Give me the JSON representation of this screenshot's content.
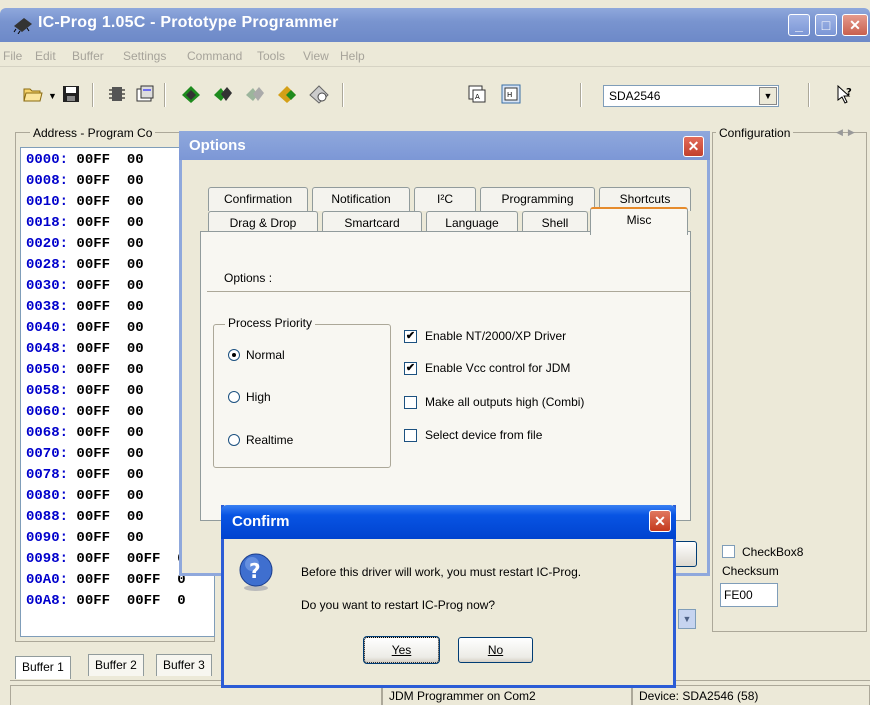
{
  "window": {
    "title": "IC-Prog 1.05C - Prototype Programmer",
    "min": "_",
    "max": "□",
    "close": "✕"
  },
  "menu": [
    "File",
    "Edit",
    "Buffer",
    "Settings",
    "Command",
    "Tools",
    "View",
    "Help"
  ],
  "toolbar": {
    "device": "SDA2546"
  },
  "address_panel": {
    "caption": "Address - Program Co",
    "rows": [
      {
        "addr": "0000:",
        "data": "00FF  00"
      },
      {
        "addr": "0008:",
        "data": "00FF  00"
      },
      {
        "addr": "0010:",
        "data": "00FF  00"
      },
      {
        "addr": "0018:",
        "data": "00FF  00"
      },
      {
        "addr": "0020:",
        "data": "00FF  00"
      },
      {
        "addr": "0028:",
        "data": "00FF  00"
      },
      {
        "addr": "0030:",
        "data": "00FF  00"
      },
      {
        "addr": "0038:",
        "data": "00FF  00"
      },
      {
        "addr": "0040:",
        "data": "00FF  00"
      },
      {
        "addr": "0048:",
        "data": "00FF  00"
      },
      {
        "addr": "0050:",
        "data": "00FF  00"
      },
      {
        "addr": "0058:",
        "data": "00FF  00"
      },
      {
        "addr": "0060:",
        "data": "00FF  00"
      },
      {
        "addr": "0068:",
        "data": "00FF  00"
      },
      {
        "addr": "0070:",
        "data": "00FF  00"
      },
      {
        "addr": "0078:",
        "data": "00FF  00"
      },
      {
        "addr": "0080:",
        "data": "00FF  00"
      },
      {
        "addr": "0088:",
        "data": "00FF  00"
      },
      {
        "addr": "0090:",
        "data": "00FF  00"
      },
      {
        "addr": "0098:",
        "data": "00FF  00FF  0"
      },
      {
        "addr": "00A0:",
        "data": "00FF  00FF  0"
      },
      {
        "addr": "00A8:",
        "data": "00FF  00FF  0"
      }
    ]
  },
  "config_panel": {
    "caption": "Configuration",
    "checkbox8": "CheckBox8",
    "checksum_label": "Checksum",
    "checksum_value": "FE00"
  },
  "buffer_tabs": [
    "Buffer 1",
    "Buffer 2",
    "Buffer 3"
  ],
  "status": {
    "programmer": "JDM Programmer on Com2",
    "device": "Device: SDA2546  (58)"
  },
  "options_dialog": {
    "title": "Options",
    "tabs_row1": [
      "Confirmation",
      "Notification",
      "I²C",
      "Programming",
      "Shortcuts"
    ],
    "tabs_row2": [
      "Drag & Drop",
      "Smartcard",
      "Language",
      "Shell",
      "Misc"
    ],
    "active_tab": "Misc",
    "panel_label": "Options :",
    "priority_caption": "Process Priority",
    "priorities": [
      {
        "label": "Normal",
        "selected": true
      },
      {
        "label": "High",
        "selected": false
      },
      {
        "label": "Realtime",
        "selected": false
      }
    ],
    "checkboxes": [
      {
        "label": "Enable NT/2000/XP Driver",
        "checked": true
      },
      {
        "label": "Enable Vcc control for JDM",
        "checked": true
      },
      {
        "label": "Make all outputs high (Combi)",
        "checked": false
      },
      {
        "label": "Select device from file",
        "checked": false
      }
    ]
  },
  "confirm_dialog": {
    "title": "Confirm",
    "line1": "Before this driver will work, you must restart IC-Prog.",
    "line2": "Do you want to restart IC-Prog now?",
    "yes": "Yes",
    "no": "No",
    "icon": "question-icon"
  }
}
